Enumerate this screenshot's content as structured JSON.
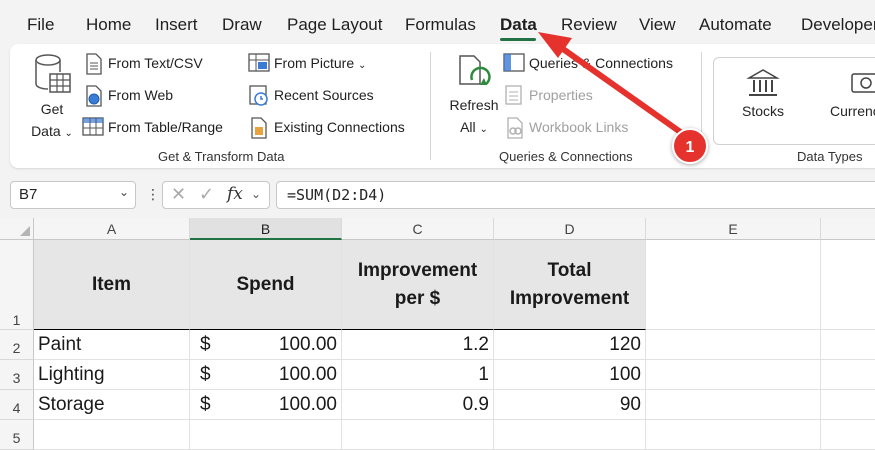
{
  "ribbon_tabs": [
    "File",
    "Home",
    "Insert",
    "Draw",
    "Page Layout",
    "Formulas",
    "Data",
    "Review",
    "View",
    "Automate",
    "Developer"
  ],
  "active_tab": "Data",
  "get_transform": {
    "get_data_label_1": "Get",
    "get_data_label_2": "Data",
    "from_text_csv": "From Text/CSV",
    "from_web": "From Web",
    "from_table_range": "From Table/Range",
    "from_picture": "From Picture",
    "recent_sources": "Recent Sources",
    "existing_connections": "Existing Connections",
    "group_label": "Get & Transform Data"
  },
  "queries": {
    "refresh_label_1": "Refresh",
    "refresh_label_2": "All",
    "queries_connections": "Queries & Connections",
    "properties": "Properties",
    "workbook_links": "Workbook Links",
    "group_label": "Queries & Connections"
  },
  "data_types": {
    "stocks": "Stocks",
    "currencies": "Currencies",
    "group_label": "Data Types"
  },
  "formula_bar": {
    "name_box": "B7",
    "fx": "fx",
    "formula": "=SUM(D2:D4)"
  },
  "columns": [
    "A",
    "B",
    "C",
    "D",
    "E"
  ],
  "rows": [
    "1",
    "2",
    "3",
    "4",
    "5"
  ],
  "table": {
    "headers": {
      "item": "Item",
      "spend": "Spend",
      "improvement_1": "Improvement",
      "improvement_2": "per $",
      "total_1": "Total",
      "total_2": "Improvement"
    },
    "data": [
      {
        "item": "Paint",
        "currency": "$",
        "spend": "100.00",
        "improvement": "1.2",
        "total": "120"
      },
      {
        "item": "Lighting",
        "currency": "$",
        "spend": "100.00",
        "improvement": "1",
        "total": "100"
      },
      {
        "item": "Storage",
        "currency": "$",
        "spend": "100.00",
        "improvement": "0.9",
        "total": "90"
      }
    ]
  },
  "annotation": {
    "badge": "1"
  },
  "colors": {
    "accent": "#217346",
    "annotation": "#e5322d"
  }
}
